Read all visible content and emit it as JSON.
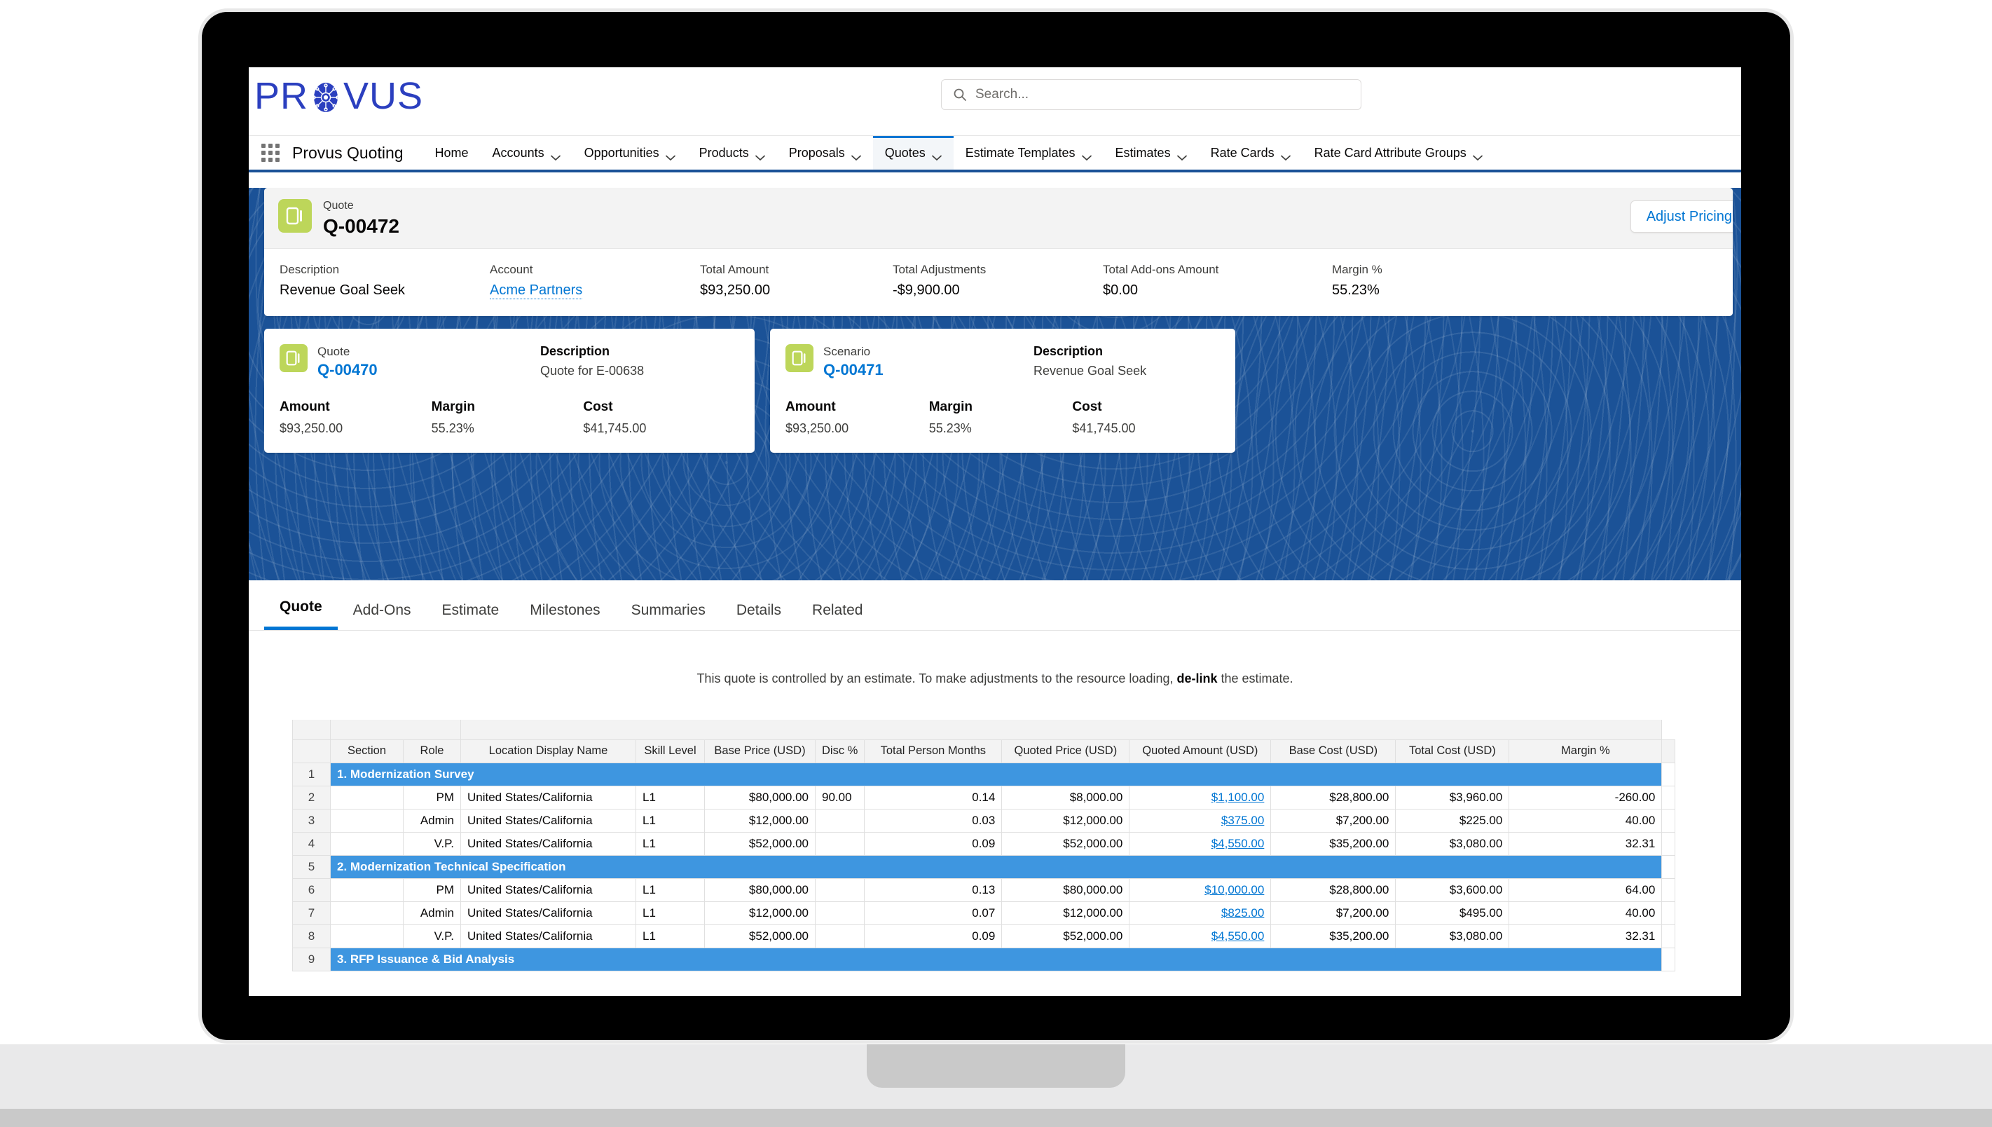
{
  "header": {
    "logo_text_left": "PR",
    "logo_text_right": "VUS",
    "app_name": "Provus Quoting",
    "app_launcher_icon": "waffle-grid-icon",
    "search": {
      "icon": "search-icon",
      "placeholder": "Search...",
      "value": ""
    }
  },
  "nav": {
    "items": [
      {
        "label": "Home",
        "has_menu": false,
        "active": false
      },
      {
        "label": "Accounts",
        "has_menu": true,
        "active": false
      },
      {
        "label": "Opportunities",
        "has_menu": true,
        "active": false
      },
      {
        "label": "Products",
        "has_menu": true,
        "active": false
      },
      {
        "label": "Proposals",
        "has_menu": true,
        "active": false
      },
      {
        "label": "Quotes",
        "has_menu": true,
        "active": true
      },
      {
        "label": "Estimate Templates",
        "has_menu": true,
        "active": false
      },
      {
        "label": "Estimates",
        "has_menu": true,
        "active": false
      },
      {
        "label": "Rate Cards",
        "has_menu": true,
        "active": false
      },
      {
        "label": "Rate Card Attribute Groups",
        "has_menu": true,
        "active": false
      }
    ]
  },
  "record": {
    "icon": "quote-object-icon",
    "object_label": "Quote",
    "name": "Q-00472",
    "adjust_button": "Adjust Pricing",
    "fields": [
      {
        "label": "Description",
        "value": "Revenue Goal Seek",
        "link": false
      },
      {
        "label": "Account",
        "value": "Acme Partners",
        "link": true
      },
      {
        "label": "Total Amount",
        "value": "$93,250.00",
        "link": false
      },
      {
        "label": "Total Adjustments",
        "value": "-$9,900.00",
        "link": false
      },
      {
        "label": "Total Add-ons Amount",
        "value": "$0.00",
        "link": false
      },
      {
        "label": "Margin %",
        "value": "55.23%",
        "link": false
      }
    ]
  },
  "cards": [
    {
      "icon": "quote-object-icon",
      "type_label": "Quote",
      "record_name": "Q-00470",
      "description_label": "Description",
      "description_value": "Quote for E-00638",
      "metrics": [
        {
          "label": "Amount",
          "value": "$93,250.00"
        },
        {
          "label": "Margin",
          "value": "55.23%"
        },
        {
          "label": "Cost",
          "value": "$41,745.00"
        }
      ]
    },
    {
      "icon": "quote-object-icon",
      "type_label": "Scenario",
      "record_name": "Q-00471",
      "description_label": "Description",
      "description_value": "Revenue Goal Seek",
      "metrics": [
        {
          "label": "Amount",
          "value": "$93,250.00"
        },
        {
          "label": "Margin",
          "value": "55.23%"
        },
        {
          "label": "Cost",
          "value": "$41,745.00"
        }
      ]
    }
  ],
  "tabs": [
    {
      "label": "Quote",
      "active": true
    },
    {
      "label": "Add-Ons",
      "active": false
    },
    {
      "label": "Estimate",
      "active": false
    },
    {
      "label": "Milestones",
      "active": false
    },
    {
      "label": "Summaries",
      "active": false
    },
    {
      "label": "Details",
      "active": false
    },
    {
      "label": "Related",
      "active": false
    }
  ],
  "notice": {
    "part1": "This quote is controlled by an estimate. To make adjustments to the resource loading, ",
    "bold": "de-link",
    "part2": " the estimate."
  },
  "grid": {
    "columns": [
      "Section",
      "Role",
      "Location Display Name",
      "Skill Level",
      "Base Price (USD)",
      "Disc %",
      "Total Person Months",
      "Quoted Price (USD)",
      "Quoted Amount (USD)",
      "Base Cost (USD)",
      "Total Cost (USD)",
      "Margin %"
    ],
    "rows": [
      {
        "num": "1",
        "type": "section",
        "section": "1. Modernization Survey"
      },
      {
        "num": "2",
        "type": "data",
        "section": "",
        "role": "PM",
        "location": "United States/California",
        "skill_level": "L1",
        "base_price": "$80,000.00",
        "disc_pct": "90.00",
        "total_person_months": "0.14",
        "quoted_price": "$8,000.00",
        "quoted_amount": "$1,100.00",
        "base_cost": "$28,800.00",
        "total_cost": "$3,960.00",
        "margin_pct": "-260.00"
      },
      {
        "num": "3",
        "type": "data",
        "section": "",
        "role": "Admin",
        "location": "United States/California",
        "skill_level": "L1",
        "base_price": "$12,000.00",
        "disc_pct": "",
        "total_person_months": "0.03",
        "quoted_price": "$12,000.00",
        "quoted_amount": "$375.00",
        "base_cost": "$7,200.00",
        "total_cost": "$225.00",
        "margin_pct": "40.00"
      },
      {
        "num": "4",
        "type": "data",
        "section": "",
        "role": "V.P.",
        "location": "United States/California",
        "skill_level": "L1",
        "base_price": "$52,000.00",
        "disc_pct": "",
        "total_person_months": "0.09",
        "quoted_price": "$52,000.00",
        "quoted_amount": "$4,550.00",
        "base_cost": "$35,200.00",
        "total_cost": "$3,080.00",
        "margin_pct": "32.31"
      },
      {
        "num": "5",
        "type": "section",
        "section": "2. Modernization Technical Specification"
      },
      {
        "num": "6",
        "type": "data",
        "section": "",
        "role": "PM",
        "location": "United States/California",
        "skill_level": "L1",
        "base_price": "$80,000.00",
        "disc_pct": "",
        "total_person_months": "0.13",
        "quoted_price": "$80,000.00",
        "quoted_amount": "$10,000.00",
        "base_cost": "$28,800.00",
        "total_cost": "$3,600.00",
        "margin_pct": "64.00"
      },
      {
        "num": "7",
        "type": "data",
        "section": "",
        "role": "Admin",
        "location": "United States/California",
        "skill_level": "L1",
        "base_price": "$12,000.00",
        "disc_pct": "",
        "total_person_months": "0.07",
        "quoted_price": "$12,000.00",
        "quoted_amount": "$825.00",
        "base_cost": "$7,200.00",
        "total_cost": "$495.00",
        "margin_pct": "40.00"
      },
      {
        "num": "8",
        "type": "data",
        "section": "",
        "role": "V.P.",
        "location": "United States/California",
        "skill_level": "L1",
        "base_price": "$52,000.00",
        "disc_pct": "",
        "total_person_months": "0.09",
        "quoted_price": "$52,000.00",
        "quoted_amount": "$4,550.00",
        "base_cost": "$35,200.00",
        "total_cost": "$3,080.00",
        "margin_pct": "32.31"
      },
      {
        "num": "9",
        "type": "section",
        "section": "3. RFP Issuance & Bid Analysis"
      }
    ]
  },
  "colors": {
    "brand_blue": "#1b5297",
    "link_blue": "#0176d3",
    "section_blue": "#3e96e0",
    "object_green": "#bdd65a",
    "logo_blue": "#2b3fbf"
  }
}
